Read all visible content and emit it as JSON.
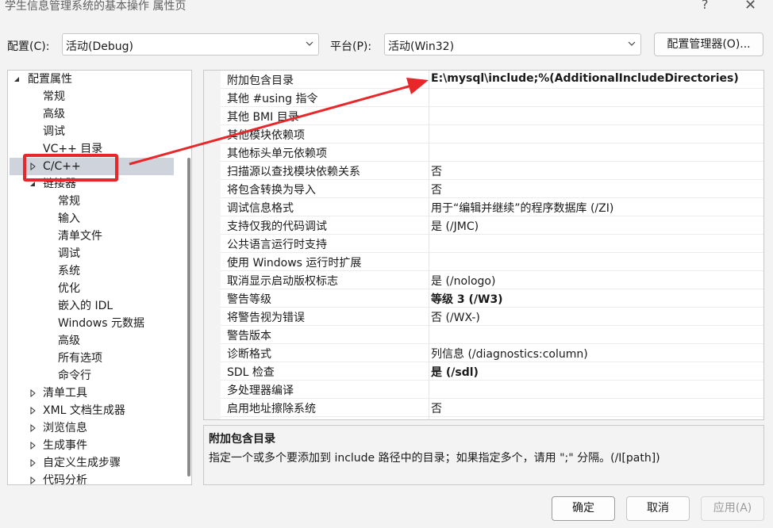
{
  "window": {
    "title": "学生信息管理系统的基本操作 属性页",
    "help": "?",
    "close": "✕"
  },
  "config": {
    "config_label": "配置(C):",
    "config_value": "活动(Debug)",
    "platform_label": "平台(P):",
    "platform_value": "活动(Win32)",
    "manager_button": "配置管理器(O)..."
  },
  "tree": {
    "root": "配置属性",
    "items": [
      "常规",
      "高级",
      "调试",
      "VC++ 目录",
      "C/C++",
      "链接器"
    ],
    "linker_children": [
      "常规",
      "输入",
      "清单文件",
      "调试",
      "系统",
      "优化",
      "嵌入的 IDL",
      "Windows 元数据",
      "高级",
      "所有选项",
      "命令行"
    ],
    "collapsed": [
      "清单工具",
      "XML 文档生成器",
      "浏览信息",
      "生成事件",
      "自定义生成步骤",
      "代码分析"
    ]
  },
  "properties": [
    {
      "name": "附加包含目录",
      "value": "E:\\mysql\\include;%(AdditionalIncludeDirectories)",
      "bold": true
    },
    {
      "name": "其他 #using 指令",
      "value": ""
    },
    {
      "name": "其他 BMI 目录",
      "value": ""
    },
    {
      "name": "其他模块依赖项",
      "value": ""
    },
    {
      "name": "其他标头单元依赖项",
      "value": ""
    },
    {
      "name": "扫描源以查找模块依赖关系",
      "value": "否"
    },
    {
      "name": "将包含转换为导入",
      "value": "否"
    },
    {
      "name": "调试信息格式",
      "value": "用于“编辑并继续”的程序数据库 (/ZI)"
    },
    {
      "name": "支持仅我的代码调试",
      "value": "是 (/JMC)"
    },
    {
      "name": "公共语言运行时支持",
      "value": ""
    },
    {
      "name": "使用 Windows 运行时扩展",
      "value": ""
    },
    {
      "name": "取消显示启动版权标志",
      "value": "是 (/nologo)"
    },
    {
      "name": "警告等级",
      "value": "等级 3 (/W3)",
      "bold": true
    },
    {
      "name": "将警告视为错误",
      "value": "否 (/WX-)"
    },
    {
      "name": "警告版本",
      "value": ""
    },
    {
      "name": "诊断格式",
      "value": "列信息 (/diagnostics:column)"
    },
    {
      "name": "SDL 检查",
      "value": "是 (/sdl)",
      "bold": true
    },
    {
      "name": "多处理器编译",
      "value": ""
    },
    {
      "name": "启用地址擦除系统",
      "value": "否"
    }
  ],
  "description": {
    "title": "附加包含目录",
    "text": "指定一个或多个要添加到 include 路径中的目录；如果指定多个，请用 \";\" 分隔。(/I[path])"
  },
  "buttons": {
    "ok": "确定",
    "cancel": "取消",
    "apply": "应用(A)"
  },
  "annotation": {
    "color": "#e8272a"
  }
}
